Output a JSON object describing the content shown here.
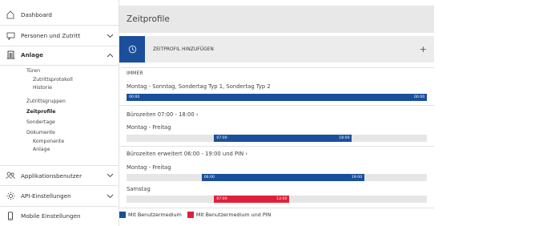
{
  "colors": {
    "accent": "#1b4f9b",
    "pin": "#e0203b",
    "track": "#e6e6e6"
  },
  "sidebar": {
    "items": [
      {
        "label": "Dashboard",
        "icon": "home-icon"
      },
      {
        "label": "Personen und Zutritt",
        "icon": "chat-icon"
      },
      {
        "label": "Anlage",
        "icon": "building-icon"
      },
      {
        "label": "Applikationsbenutzer",
        "icon": "users-icon"
      },
      {
        "label": "API-Einstellungen",
        "icon": "gear-icon"
      },
      {
        "label": "Mobile Einstellungen",
        "icon": "mobile-icon"
      }
    ],
    "anlage_sub": {
      "tueren": "Türen",
      "zutrittsprotokoll": "Zutrittsprotokoll",
      "historie": "Historie",
      "zutrittsgruppen": "Zutrittsgruppen",
      "zeitprofile": "Zeitprofile",
      "sondertage": "Sondertage",
      "dokumente": "Dokumente",
      "komponente": "Komponente",
      "anlage": "Anlage"
    }
  },
  "main": {
    "title": "Zeitprofile",
    "add_label": "ZEITPROFIL HINZUFÜGEN",
    "add_symbol": "+",
    "profiles": [
      {
        "name": "IMMER",
        "rows": [
          {
            "days": "Montag - Sonntag, Sondertag Typ 1, Sondertag Typ 2",
            "start": "00:00",
            "end": "00:00",
            "start_frac": 0.0,
            "end_frac": 1.0,
            "type": "medium"
          }
        ]
      },
      {
        "name": "Bürozeiten 07:00 - 18:00",
        "link_symbol": "›",
        "rows": [
          {
            "days": "Montag - Freitag",
            "start": "07:00",
            "end": "18:00",
            "start_frac": 0.2917,
            "end_frac": 0.75,
            "type": "medium"
          }
        ]
      },
      {
        "name": "Bürozeiten erweitert 06:00 - 19:00 und PIN",
        "link_symbol": "›",
        "rows": [
          {
            "days": "Montag - Freitag",
            "start": "06:00",
            "end": "19:00",
            "start_frac": 0.25,
            "end_frac": 0.7917,
            "type": "medium"
          },
          {
            "days": "Samstag",
            "start": "07:00",
            "end": "13:00",
            "start_frac": 0.2917,
            "end_frac": 0.5417,
            "type": "pin"
          }
        ]
      }
    ]
  },
  "legend": {
    "medium": "Mit Benutzermedium",
    "pin": "Mit Benutzermedium und PIN"
  }
}
